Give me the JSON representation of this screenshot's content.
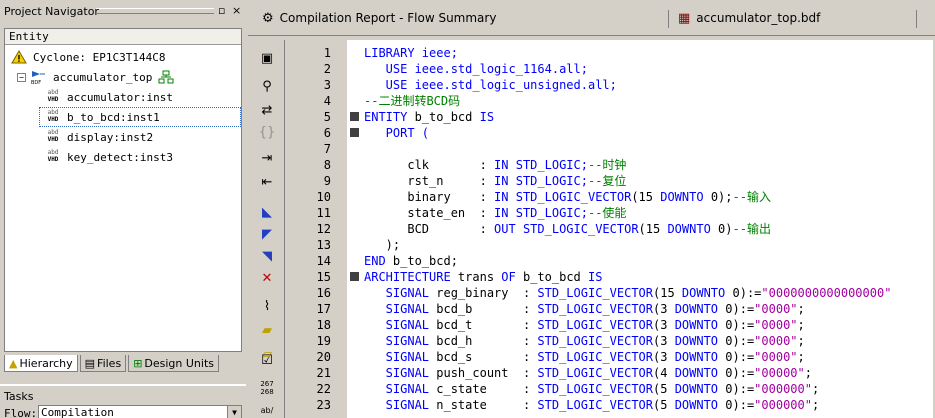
{
  "navigator": {
    "title": "Project Navigator",
    "close": "×",
    "header": "Entity",
    "items": [
      {
        "label": "Cyclone: EP1C3T144C8"
      },
      {
        "label": "accumulator_top"
      },
      {
        "label": "accumulator:inst"
      },
      {
        "label": "b_to_bcd:inst1"
      },
      {
        "label": "display:inst2"
      },
      {
        "label": "key_detect:inst3"
      }
    ],
    "tabs": [
      "Hierarchy",
      "Files",
      "Design Units"
    ]
  },
  "tasks": {
    "title": "Tasks",
    "flow_label": "Flow:",
    "flow_value": "Compilation"
  },
  "doc_tabs": [
    {
      "label": "Compilation Report - Flow Summary"
    },
    {
      "label": "accumulator_top.bdf"
    }
  ],
  "toolbar_side": {
    "counter_top": "267",
    "counter_bottom": "268",
    "bottom_label": "ab/"
  },
  "editor": {
    "lines": [
      {
        "n": "1",
        "tokens": [
          {
            "t": "LIBRARY ieee;",
            "c": "k"
          }
        ]
      },
      {
        "n": "2",
        "tokens": [
          {
            "t": "   USE ieee.std_logic_1164.all;",
            "c": "k"
          }
        ]
      },
      {
        "n": "3",
        "tokens": [
          {
            "t": "   USE ieee.std_logic_unsigned.all;",
            "c": "k"
          }
        ]
      },
      {
        "n": "4",
        "tokens": [
          {
            "t": "--二进制转BCD码",
            "c": "c"
          }
        ]
      },
      {
        "n": "5",
        "fold": true,
        "tokens": [
          {
            "t": "ENTITY ",
            "c": "k"
          },
          {
            "t": "b_to_bcd ",
            "c": "n"
          },
          {
            "t": "IS",
            "c": "k"
          }
        ]
      },
      {
        "n": "6",
        "fold": true,
        "tokens": [
          {
            "t": "   PORT (",
            "c": "k"
          }
        ]
      },
      {
        "n": "7",
        "tokens": []
      },
      {
        "n": "8",
        "tokens": [
          {
            "t": "      clk       : ",
            "c": "n"
          },
          {
            "t": "IN STD_LOGIC;",
            "c": "k"
          },
          {
            "t": "--时钟",
            "c": "c"
          }
        ]
      },
      {
        "n": "9",
        "tokens": [
          {
            "t": "      rst_n     : ",
            "c": "n"
          },
          {
            "t": "IN STD_LOGIC;",
            "c": "k"
          },
          {
            "t": "--复位",
            "c": "c"
          }
        ]
      },
      {
        "n": "10",
        "tokens": [
          {
            "t": "      binary    : ",
            "c": "n"
          },
          {
            "t": "IN STD_LOGIC_VECTOR",
            "c": "k"
          },
          {
            "t": "(15 ",
            "c": "n"
          },
          {
            "t": "DOWNTO",
            "c": "k"
          },
          {
            "t": " 0);",
            "c": "n"
          },
          {
            "t": "--输入",
            "c": "c"
          }
        ]
      },
      {
        "n": "11",
        "tokens": [
          {
            "t": "      state_en  : ",
            "c": "n"
          },
          {
            "t": "IN STD_LOGIC;",
            "c": "k"
          },
          {
            "t": "--使能",
            "c": "c"
          }
        ]
      },
      {
        "n": "12",
        "tokens": [
          {
            "t": "      BCD       : ",
            "c": "n"
          },
          {
            "t": "OUT STD_LOGIC_VECTOR",
            "c": "k"
          },
          {
            "t": "(15 ",
            "c": "n"
          },
          {
            "t": "DOWNTO",
            "c": "k"
          },
          {
            "t": " 0)",
            "c": "n"
          },
          {
            "t": "--输出",
            "c": "c"
          }
        ]
      },
      {
        "n": "13",
        "tokens": [
          {
            "t": "   );",
            "c": "n"
          }
        ]
      },
      {
        "n": "14",
        "tokens": [
          {
            "t": "END ",
            "c": "k"
          },
          {
            "t": "b_to_bcd;",
            "c": "n"
          }
        ]
      },
      {
        "n": "15",
        "fold": true,
        "tokens": [
          {
            "t": "ARCHITECTURE ",
            "c": "k"
          },
          {
            "t": "trans ",
            "c": "n"
          },
          {
            "t": "OF ",
            "c": "k"
          },
          {
            "t": "b_to_bcd ",
            "c": "n"
          },
          {
            "t": "IS",
            "c": "k"
          }
        ]
      },
      {
        "n": "16",
        "tokens": [
          {
            "t": "   SIGNAL ",
            "c": "k"
          },
          {
            "t": "reg_binary  : ",
            "c": "n"
          },
          {
            "t": "STD_LOGIC_VECTOR",
            "c": "k"
          },
          {
            "t": "(15 ",
            "c": "n"
          },
          {
            "t": "DOWNTO",
            "c": "k"
          },
          {
            "t": " 0):=",
            "c": "n"
          },
          {
            "t": "\"0000000000000000\"",
            "c": "s"
          }
        ]
      },
      {
        "n": "17",
        "tokens": [
          {
            "t": "   SIGNAL ",
            "c": "k"
          },
          {
            "t": "bcd_b       : ",
            "c": "n"
          },
          {
            "t": "STD_LOGIC_VECTOR",
            "c": "k"
          },
          {
            "t": "(3 ",
            "c": "n"
          },
          {
            "t": "DOWNTO",
            "c": "k"
          },
          {
            "t": " 0):=",
            "c": "n"
          },
          {
            "t": "\"0000\"",
            "c": "s"
          },
          {
            "t": ";",
            "c": "n"
          }
        ]
      },
      {
        "n": "18",
        "tokens": [
          {
            "t": "   SIGNAL ",
            "c": "k"
          },
          {
            "t": "bcd_t       : ",
            "c": "n"
          },
          {
            "t": "STD_LOGIC_VECTOR",
            "c": "k"
          },
          {
            "t": "(3 ",
            "c": "n"
          },
          {
            "t": "DOWNTO",
            "c": "k"
          },
          {
            "t": " 0):=",
            "c": "n"
          },
          {
            "t": "\"0000\"",
            "c": "s"
          },
          {
            "t": ";",
            "c": "n"
          }
        ]
      },
      {
        "n": "19",
        "tokens": [
          {
            "t": "   SIGNAL ",
            "c": "k"
          },
          {
            "t": "bcd_h       : ",
            "c": "n"
          },
          {
            "t": "STD_LOGIC_VECTOR",
            "c": "k"
          },
          {
            "t": "(3 ",
            "c": "n"
          },
          {
            "t": "DOWNTO",
            "c": "k"
          },
          {
            "t": " 0):=",
            "c": "n"
          },
          {
            "t": "\"0000\"",
            "c": "s"
          },
          {
            "t": ";",
            "c": "n"
          }
        ]
      },
      {
        "n": "20",
        "tokens": [
          {
            "t": "   SIGNAL ",
            "c": "k"
          },
          {
            "t": "bcd_s       : ",
            "c": "n"
          },
          {
            "t": "STD_LOGIC_VECTOR",
            "c": "k"
          },
          {
            "t": "(3 ",
            "c": "n"
          },
          {
            "t": "DOWNTO",
            "c": "k"
          },
          {
            "t": " 0):=",
            "c": "n"
          },
          {
            "t": "\"0000\"",
            "c": "s"
          },
          {
            "t": ";",
            "c": "n"
          }
        ]
      },
      {
        "n": "21",
        "tokens": [
          {
            "t": "   SIGNAL ",
            "c": "k"
          },
          {
            "t": "push_count  : ",
            "c": "n"
          },
          {
            "t": "STD_LOGIC_VECTOR",
            "c": "k"
          },
          {
            "t": "(4 ",
            "c": "n"
          },
          {
            "t": "DOWNTO",
            "c": "k"
          },
          {
            "t": " 0):=",
            "c": "n"
          },
          {
            "t": "\"00000\"",
            "c": "s"
          },
          {
            "t": ";",
            "c": "n"
          }
        ]
      },
      {
        "n": "22",
        "tokens": [
          {
            "t": "   SIGNAL ",
            "c": "k"
          },
          {
            "t": "c_state     : ",
            "c": "n"
          },
          {
            "t": "STD_LOGIC_VECTOR",
            "c": "k"
          },
          {
            "t": "(5 ",
            "c": "n"
          },
          {
            "t": "DOWNTO",
            "c": "k"
          },
          {
            "t": " 0):=",
            "c": "n"
          },
          {
            "t": "\"000000\"",
            "c": "s"
          },
          {
            "t": ";",
            "c": "n"
          }
        ]
      },
      {
        "n": "23",
        "tokens": [
          {
            "t": "   SIGNAL ",
            "c": "k"
          },
          {
            "t": "n_state     : ",
            "c": "n"
          },
          {
            "t": "STD_LOGIC_VECTOR",
            "c": "k"
          },
          {
            "t": "(5 ",
            "c": "n"
          },
          {
            "t": "DOWNTO",
            "c": "k"
          },
          {
            "t": " 0):=",
            "c": "n"
          },
          {
            "t": "\"000000\"",
            "c": "s"
          },
          {
            "t": ";",
            "c": "n"
          }
        ]
      }
    ]
  }
}
